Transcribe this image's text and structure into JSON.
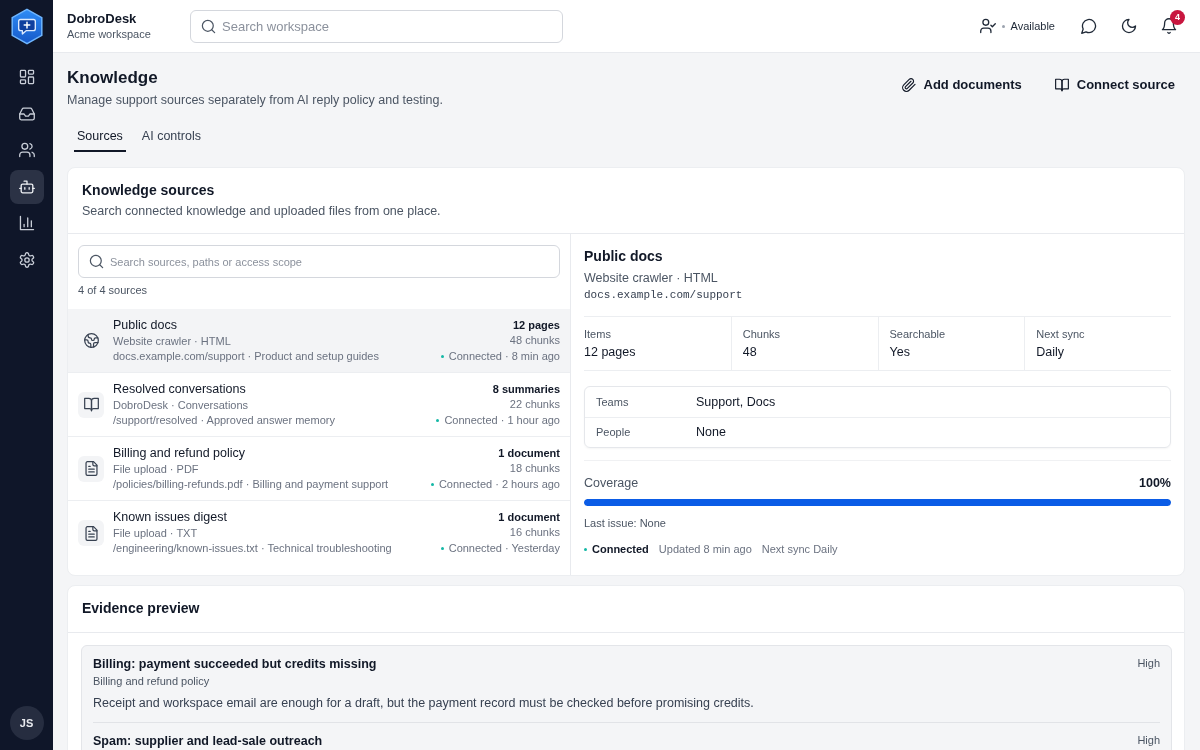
{
  "sidebar": {
    "items": [
      {
        "selected": false
      },
      {
        "selected": false
      },
      {
        "selected": false
      },
      {
        "selected": true
      },
      {
        "selected": false
      },
      {
        "selected": false
      }
    ],
    "avatar": "JS"
  },
  "header": {
    "brand": "DobroDesk",
    "workspace": "Acme workspace",
    "search": {
      "placeholder": "Search workspace"
    },
    "status": "Available",
    "notifications": "4"
  },
  "page": {
    "title": "Knowledge",
    "subtitle": "Manage support sources separately from AI reply policy and testing.",
    "actions": [
      "Add documents",
      "Connect source"
    ],
    "tabs": [
      {
        "label": "Sources",
        "selected": true
      },
      {
        "label": "AI controls",
        "selected": false
      }
    ]
  },
  "sources": {
    "title": "Knowledge sources",
    "subtitle": "Search connected knowledge and uploaded files from one place.",
    "search": {
      "placeholder": "Search sources, paths or access scope"
    },
    "count": "4 of 4 sources",
    "items": [
      {
        "kind": "website",
        "title": "Public docs",
        "meta": "Website crawler · HTML",
        "path": "docs.example.com/support · Product and setup guides",
        "size": "12 pages",
        "chunks": "48 chunks",
        "status": "Connected · 8 min ago",
        "selected": true
      },
      {
        "kind": "conversations",
        "title": "Resolved conversations",
        "meta": "DobroDesk · Conversations",
        "path": "/support/resolved · Approved answer memory",
        "size": "8 summaries",
        "chunks": "22 chunks",
        "status": "Connected · 1 hour ago",
        "selected": false
      },
      {
        "kind": "file",
        "title": "Billing and refund policy",
        "meta": "File upload · PDF",
        "path": "/policies/billing-refunds.pdf · Billing and payment support",
        "size": "1 document",
        "chunks": "18 chunks",
        "status": "Connected · 2 hours ago",
        "selected": false
      },
      {
        "kind": "file",
        "title": "Known issues digest",
        "meta": "File upload · TXT",
        "path": "/engineering/known-issues.txt · Technical troubleshooting",
        "size": "1 document",
        "chunks": "16 chunks",
        "status": "Connected · Yesterday",
        "selected": false
      }
    ]
  },
  "detail": {
    "title": "Public docs",
    "meta": "Website crawler · HTML",
    "url": "docs.example.com/support",
    "stats": [
      {
        "label": "Items",
        "value": "12 pages"
      },
      {
        "label": "Chunks",
        "value": "48"
      },
      {
        "label": "Searchable",
        "value": "Yes"
      },
      {
        "label": "Next sync",
        "value": "Daily"
      }
    ],
    "access": [
      {
        "label": "Teams",
        "value": "Support, Docs"
      },
      {
        "label": "People",
        "value": "None"
      }
    ],
    "coverage": {
      "label": "Coverage",
      "reading": "100%",
      "level": 1
    },
    "last_issue": "Last issue: None",
    "footer": {
      "status": "Connected",
      "updated": "Updated 8 min ago",
      "next_sync": "Next sync Daily"
    }
  },
  "evidence": {
    "title": "Evidence preview",
    "items": [
      {
        "title": "Billing: payment succeeded but credits missing",
        "priority": "High",
        "source": "Billing and refund policy",
        "body": "Receipt and workspace email are enough for a draft, but the payment record must be checked before promising credits."
      },
      {
        "title": "Spam: supplier and lead-sale outreach",
        "priority": "High"
      }
    ]
  }
}
